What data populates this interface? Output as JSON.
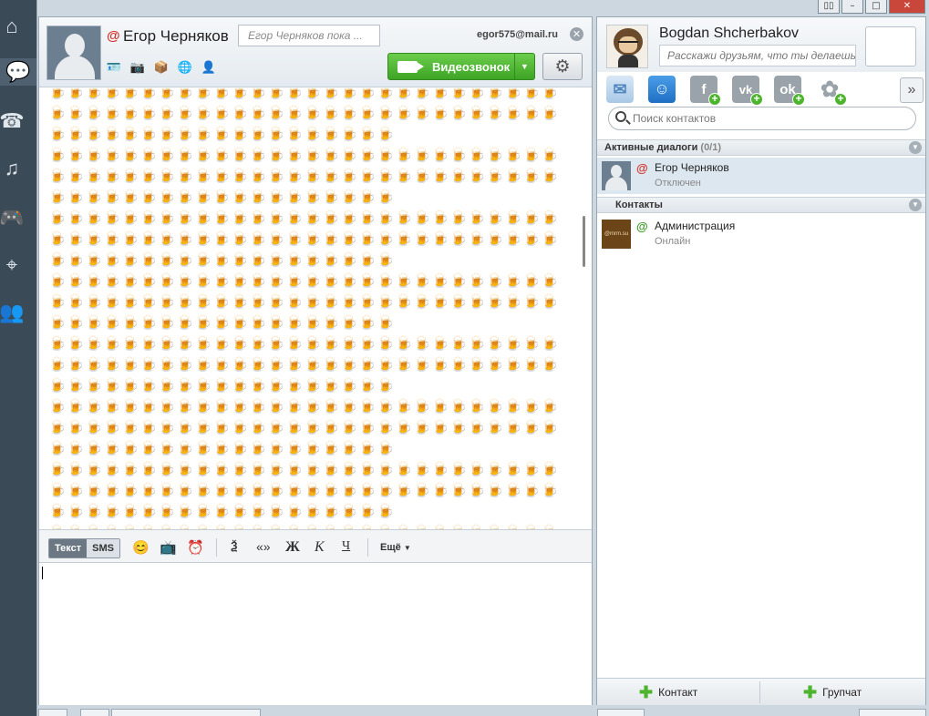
{
  "window": {
    "controls": [
      "▯▯",
      "–",
      "□",
      "✕"
    ]
  },
  "sidebar": {
    "icons": [
      "home-icon",
      "chat-icon",
      "phone-icon",
      "music-icon",
      "games-icon",
      "map-icon",
      "people-icon"
    ]
  },
  "chat": {
    "contact_name": "Егор Черняков",
    "status_placeholder": "Егор Черняков пока ...",
    "email": "egor575@mail.ru",
    "video_call_label": "Видеозвонок",
    "message_emoji": "🍺",
    "message_rows": [
      28,
      28,
      19,
      28,
      28,
      19,
      28,
      28,
      19,
      28,
      28,
      19,
      28,
      28,
      19,
      28,
      28,
      19,
      28,
      28,
      19,
      28
    ],
    "toolbar": {
      "mode_text": "Текст",
      "mode_sms": "SMS",
      "translit": "Ѯ",
      "quotes": "«»",
      "bold": "Ж",
      "italic": "К",
      "underline": "Ч",
      "more": "Ещё"
    },
    "compose_value": ""
  },
  "profile": {
    "name": "Bogdan Shcherbakov",
    "status_placeholder": "Расскажи друзьям, что ты делаешь..."
  },
  "search": {
    "placeholder": "Поиск контактов"
  },
  "sections": {
    "active_label": "Активные диалоги",
    "active_count": "(0/1)",
    "contacts_label": "Контакты"
  },
  "active_dialogs": [
    {
      "name": "Егор Черняков",
      "status": "Отключен",
      "status_color": "#d3332a"
    }
  ],
  "contacts_list": [
    {
      "name": "Администрация",
      "status": "Онлайн",
      "status_color": "#3a9a24",
      "avatar_text": "@mrm.su"
    }
  ],
  "footer": {
    "add_contact": "Контакт",
    "group_chat": "Групчат"
  },
  "colors": {
    "accent_green": "#4db52d",
    "offline_red": "#d3332a",
    "sidebar_bg": "#3b4a57"
  }
}
